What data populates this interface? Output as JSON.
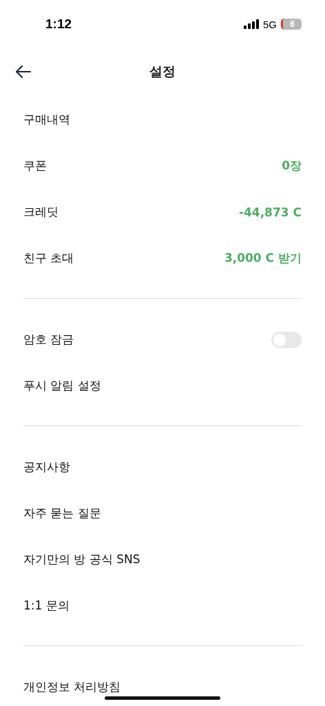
{
  "status_bar": {
    "time": "1:12",
    "network": "5G",
    "battery": "6"
  },
  "header": {
    "title": "설정"
  },
  "sections": [
    {
      "items": [
        {
          "kind": "link",
          "label": "구매내역"
        },
        {
          "kind": "value",
          "label": "쿠폰",
          "value": "0장"
        },
        {
          "kind": "value",
          "label": "크레딧",
          "value": "-44,873 C"
        },
        {
          "kind": "value",
          "label": "친구 초대",
          "value": "3,000 C 받기"
        }
      ]
    },
    {
      "items": [
        {
          "kind": "toggle",
          "label": "암호 잠금",
          "on": false
        },
        {
          "kind": "link",
          "label": "푸시 알림 설정"
        }
      ]
    },
    {
      "items": [
        {
          "kind": "link",
          "label": "공지사항"
        },
        {
          "kind": "link",
          "label": "자주 묻는 질문"
        },
        {
          "kind": "link",
          "label": "자기만의 방 공식 SNS"
        },
        {
          "kind": "link",
          "label": "1:1 문의"
        }
      ]
    },
    {
      "items": [
        {
          "kind": "link",
          "label": "개인정보 처리방침"
        }
      ]
    }
  ]
}
